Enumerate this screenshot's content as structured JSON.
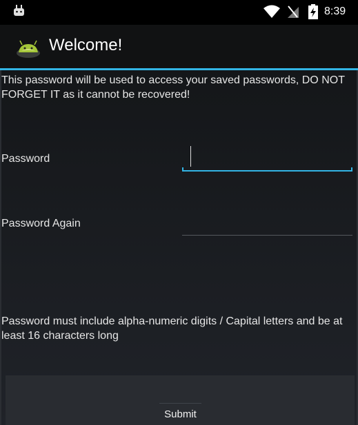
{
  "status_bar": {
    "time": "8:39",
    "icons": [
      "android-icon",
      "wifi-icon",
      "no-sim-icon",
      "battery-charging-icon"
    ]
  },
  "action_bar": {
    "title": "Welcome!",
    "logo_icon": "android-logo-icon"
  },
  "content": {
    "intro": "This password will be used to access your saved passwords, DO NOT FORGET IT as it cannot be recovered!",
    "password_label": "Password",
    "password_value": "",
    "password_again_label": "Password Again",
    "password_again_value": "",
    "requirements": "Password must include alpha-numeric digits / Capital letters and be at least 16 characters long"
  },
  "footer": {
    "submit_label": "Submit"
  },
  "colors": {
    "accent": "#33b5e5",
    "background_top": "#121416",
    "background_bottom": "#202329"
  }
}
